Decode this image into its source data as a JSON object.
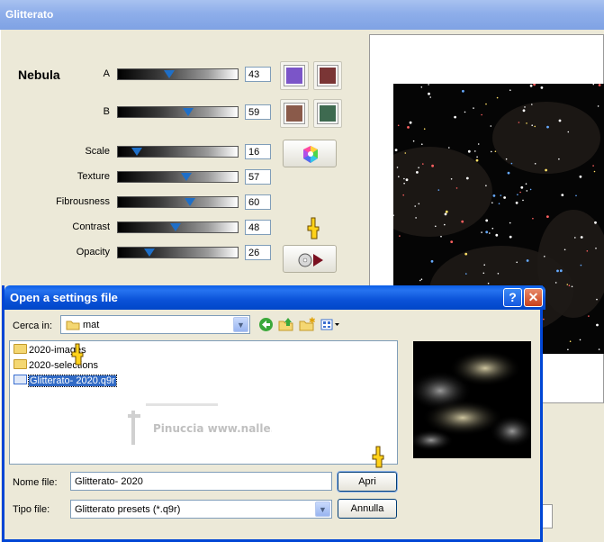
{
  "main_window": {
    "title": "Glitterato",
    "section": "Nebula",
    "sliders": [
      {
        "label": "A",
        "value": "43",
        "level": 0.43
      },
      {
        "label": "B",
        "value": "59",
        "level": 0.59
      },
      {
        "label": "Scale",
        "value": "16",
        "level": 0.16
      },
      {
        "label": "Texture",
        "value": "57",
        "level": 0.57
      },
      {
        "label": "Fibrousness",
        "value": "60",
        "level": 0.6
      },
      {
        "label": "Contrast",
        "value": "48",
        "level": 0.48
      },
      {
        "label": "Opacity",
        "value": "26",
        "level": 0.26
      }
    ],
    "colors": {
      "a_primary": "#7B55C8",
      "a_secondary": "#7A3535",
      "b_primary": "#8A5A4A",
      "b_secondary": "#3E6A50"
    }
  },
  "dialog": {
    "title": "Open a settings file",
    "help_label": "?",
    "close_label": "✕",
    "look_in_label": "Cerca in:",
    "look_in_value": "mat",
    "files": [
      {
        "name": "2020-images",
        "type": "folder"
      },
      {
        "name": "2020-selections",
        "type": "folder"
      },
      {
        "name": "Glitterato- 2020.q9r",
        "type": "file",
        "selected": true
      }
    ],
    "watermark": "Pinuccia www.nalle.grafica.eu",
    "file_name_label": "Nome file:",
    "file_name_value": "Glitterato- 2020",
    "file_type_label": "Tipo file:",
    "file_type_value": "Glitterato presets (*.q9r)",
    "open_button": "Apri",
    "cancel_button": "Annulla"
  }
}
